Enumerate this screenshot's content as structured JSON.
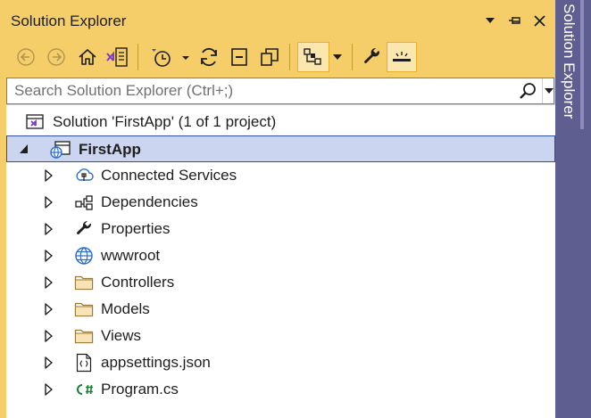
{
  "window": {
    "title": "Solution Explorer",
    "side_tab_label": "Solution Explorer"
  },
  "search": {
    "placeholder": "Search Solution Explorer (Ctrl+;)",
    "value": ""
  },
  "tree": {
    "solution_label": "Solution 'FirstApp' (1 of 1 project)",
    "project_label": "FirstApp",
    "items": [
      {
        "label": "Connected Services",
        "icon": "connected-services-icon"
      },
      {
        "label": "Dependencies",
        "icon": "dependencies-icon"
      },
      {
        "label": "Properties",
        "icon": "wrench-icon"
      },
      {
        "label": "wwwroot",
        "icon": "globe-icon"
      },
      {
        "label": "Controllers",
        "icon": "folder-icon"
      },
      {
        "label": "Models",
        "icon": "folder-icon"
      },
      {
        "label": "Views",
        "icon": "folder-icon"
      },
      {
        "label": "appsettings.json",
        "icon": "json-file-icon"
      },
      {
        "label": "Program.cs",
        "icon": "csharp-file-icon"
      }
    ]
  },
  "colors": {
    "accent": "#f5ce6a",
    "selection": "#ccd5f0",
    "selection_border": "#2f4f9c",
    "side_tab": "#5e5e90",
    "folder": "#dcb67a"
  }
}
